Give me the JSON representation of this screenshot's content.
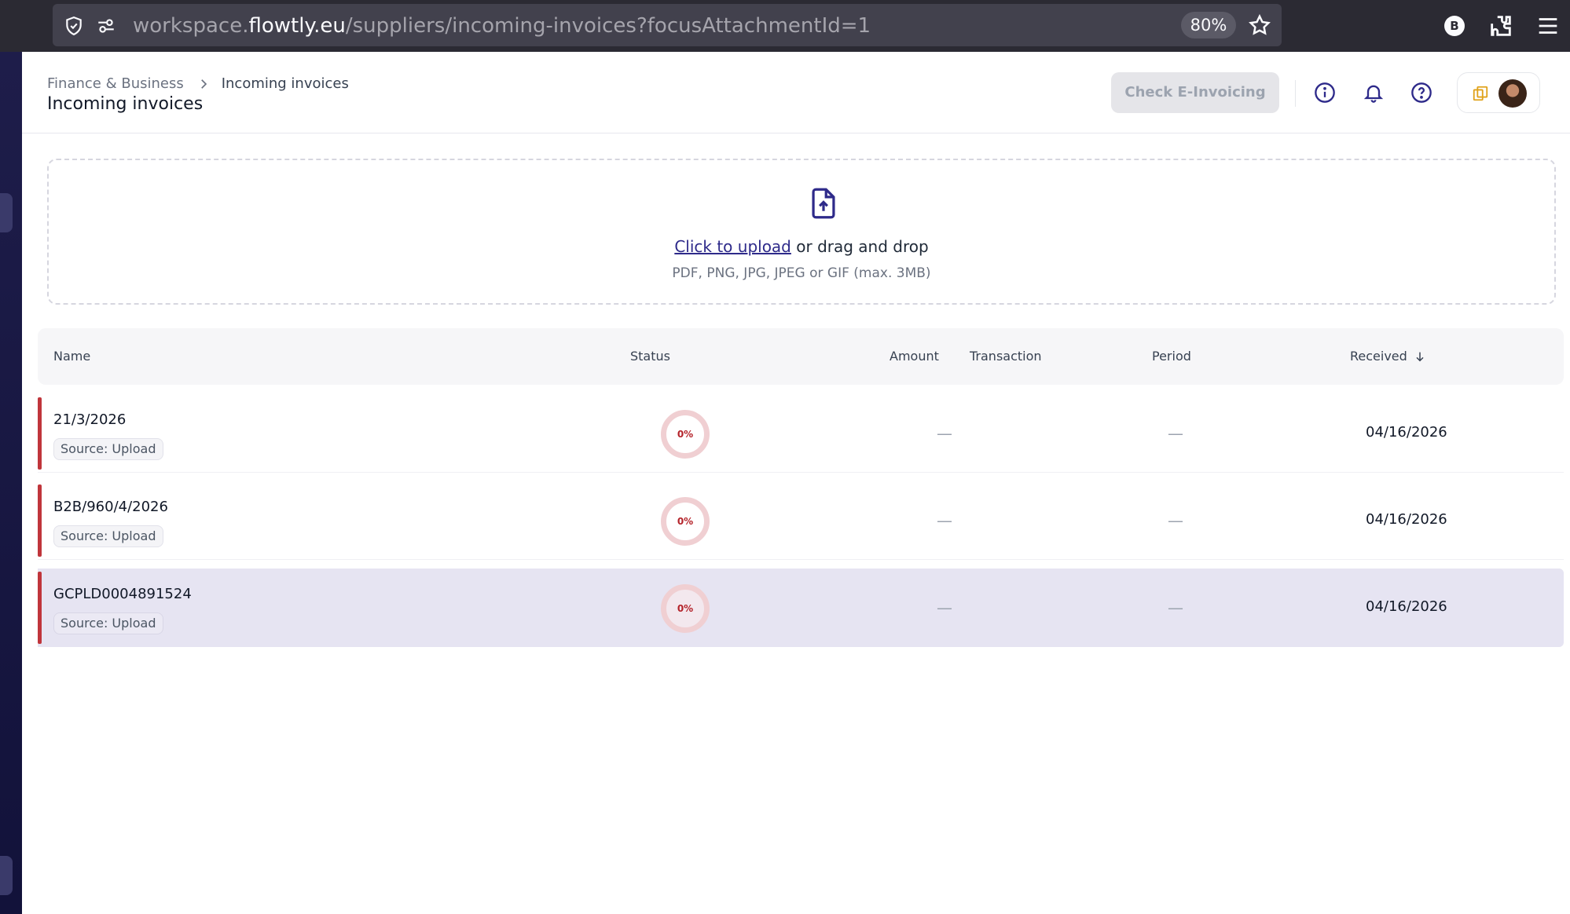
{
  "browser": {
    "url_prefix": "workspace.",
    "url_host": "flowtly.eu",
    "url_path": "/suppliers/incoming-invoices?focusAttachmentId=1",
    "zoom": "80%",
    "profile_initial": "B"
  },
  "header": {
    "breadcrumb_parent": "Finance & Business",
    "breadcrumb_current": "Incoming invoices",
    "title": "Incoming invoices",
    "check_button_label": "Check E-Invoicing"
  },
  "upload": {
    "link_text": "Click to upload",
    "rest_text": " or drag and drop",
    "hint": "PDF, PNG, JPG, JPEG or GIF (max. 3MB)"
  },
  "table": {
    "columns": {
      "name": "Name",
      "status": "Status",
      "amount": "Amount",
      "transaction": "Transaction",
      "period": "Period",
      "received": "Received"
    },
    "rows": [
      {
        "name": "21/3/2026",
        "source": "Source: Upload",
        "status": "0%",
        "amount": "—",
        "period": "—",
        "received": "04/16/2026"
      },
      {
        "name": "B2B/960/4/2026",
        "source": "Source: Upload",
        "status": "0%",
        "amount": "—",
        "period": "—",
        "received": "04/16/2026"
      },
      {
        "name": "GCPLD0004891524",
        "source": "Source: Upload",
        "status": "0%",
        "amount": "—",
        "period": "—",
        "received": "04/16/2026"
      }
    ]
  },
  "colors": {
    "accent": "#2e2a8a",
    "row_marker": "#c0353b",
    "selected_row": "#e6e4f2",
    "status_ring": "#f0cfd2"
  }
}
